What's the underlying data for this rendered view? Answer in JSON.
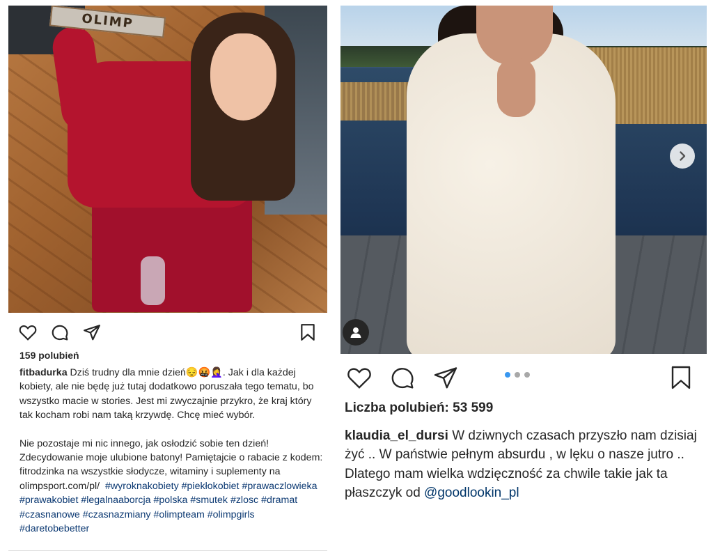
{
  "left_post": {
    "likes": "159 polubień",
    "username": "fitbadurka",
    "caption_p1": "Dziś trudny dla mnie dzień😔🤬🤦‍♀️. Jak i dla każdej kobiety, ale nie będę już tutaj dodatkowo poruszała tego tematu, bo wszystko macie w stories. Jest mi zwyczajnie przykro, że kraj który tak kocham robi nam taką krzywdę. Chcę mieć wybór.",
    "caption_p2": "Nie pozostaje mi nic innego, jak osłodzić sobie ten dzień! Zdecydowanie moje ulubione batony! Pamiętajcie o rabacie z kodem: fitrodzinka na wszystkie słodycze, witaminy i suplementy na olimpsport.com/pl/",
    "hashtags": [
      "#wyroknakobiety",
      "#piekłokobiet",
      "#prawaczlowieka",
      "#prawakobiet",
      "#legalnaaborcja",
      "#polska",
      "#smutek",
      "#zlosc",
      "#dramat",
      "#czasnanowe",
      "#czasnazmiany",
      "#olimpteam",
      "#olimpgirls",
      "#daretobebetter"
    ],
    "photo_text": "OLIMP"
  },
  "right_post": {
    "likes": "Liczba polubień: 53 599",
    "username": "klaudia_el_dursi",
    "caption_p1": "W dziwnych czasach przyszło nam dzisiaj żyć .. W państwie pełnym absurdu , w lęku o nasze jutro ..",
    "caption_p2": "Dlatego mam wielka wdzięczność za chwile takie jak ta ",
    "caption_p3_prefix": "płaszczyk od ",
    "mention": "@goodlookin_pl",
    "caption_p3_suffix": " ",
    "carousel": {
      "total": 3,
      "active": 1
    }
  },
  "icons": {
    "like": "heart-icon",
    "comment": "comment-bubble-icon",
    "share": "paper-plane-icon",
    "save": "bookmark-icon",
    "next": "chevron-right-icon",
    "avatar": "user-tag-icon"
  },
  "colors": {
    "hashtag": "#0d3a73",
    "carousel_active": "#3897f0",
    "carousel_inactive": "#a8a8a8",
    "text": "#262626"
  }
}
